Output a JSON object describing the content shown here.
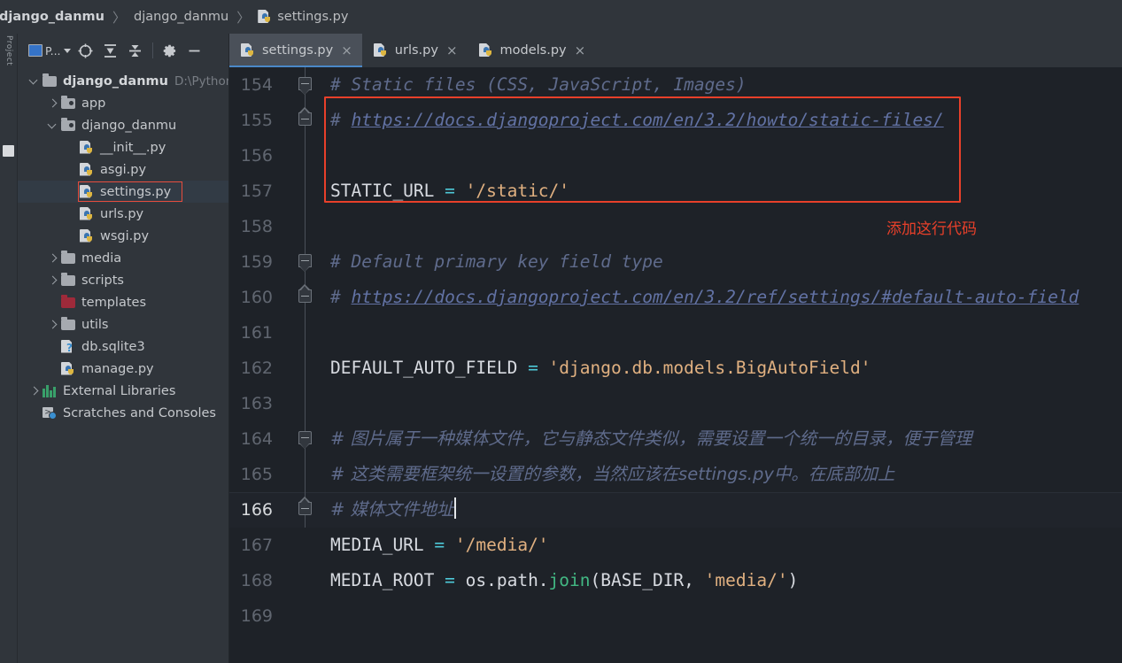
{
  "breadcrumb": {
    "items": [
      {
        "label": "django_danmu",
        "icon": "none",
        "bold": true
      },
      {
        "label": "django_danmu",
        "icon": "none",
        "bold": false
      },
      {
        "label": "settings.py",
        "icon": "python-file-icon",
        "bold": false
      }
    ],
    "separator": "〉"
  },
  "sidebar": {
    "toolbar": {
      "project_label": "P...",
      "project_icon": "project-window-icon",
      "locate_icon": "locate-target-icon",
      "expand_all_icon": "expand-all-icon",
      "collapse_all_icon": "collapse-all-icon",
      "settings_icon": "gear-icon",
      "hide_icon": "minus-icon"
    },
    "vertical_tab": "Project",
    "tree": [
      {
        "indent": 0,
        "twisty": "down",
        "icon": "folder-icon",
        "label": "django_danmu",
        "bold": true,
        "path": "D:\\Python\\",
        "selected": false
      },
      {
        "indent": 1,
        "twisty": "right",
        "icon": "source-folder-icon",
        "label": "app",
        "bold": false,
        "path": "",
        "selected": false
      },
      {
        "indent": 1,
        "twisty": "down",
        "icon": "source-folder-icon",
        "label": "django_danmu",
        "bold": false,
        "path": "",
        "selected": false
      },
      {
        "indent": 2,
        "twisty": "none",
        "icon": "python-file-icon",
        "label": "__init__.py",
        "bold": false,
        "path": "",
        "selected": false
      },
      {
        "indent": 2,
        "twisty": "none",
        "icon": "python-file-icon",
        "label": "asgi.py",
        "bold": false,
        "path": "",
        "selected": false
      },
      {
        "indent": 2,
        "twisty": "none",
        "icon": "python-file-icon",
        "label": "settings.py",
        "bold": false,
        "path": "",
        "selected": true
      },
      {
        "indent": 2,
        "twisty": "none",
        "icon": "python-file-icon",
        "label": "urls.py",
        "bold": false,
        "path": "",
        "selected": false
      },
      {
        "indent": 2,
        "twisty": "none",
        "icon": "python-file-icon",
        "label": "wsgi.py",
        "bold": false,
        "path": "",
        "selected": false
      },
      {
        "indent": 1,
        "twisty": "right",
        "icon": "folder-icon",
        "label": "media",
        "bold": false,
        "path": "",
        "selected": false
      },
      {
        "indent": 1,
        "twisty": "right",
        "icon": "folder-icon",
        "label": "scripts",
        "bold": false,
        "path": "",
        "selected": false
      },
      {
        "indent": 1,
        "twisty": "none",
        "icon": "folder-red-icon",
        "label": "templates",
        "bold": false,
        "path": "",
        "selected": false
      },
      {
        "indent": 1,
        "twisty": "right",
        "icon": "folder-icon",
        "label": "utils",
        "bold": false,
        "path": "",
        "selected": false
      },
      {
        "indent": 1,
        "twisty": "none",
        "icon": "db-file-icon",
        "label": "db.sqlite3",
        "bold": false,
        "path": "",
        "selected": false
      },
      {
        "indent": 1,
        "twisty": "none",
        "icon": "python-file-icon",
        "label": "manage.py",
        "bold": false,
        "path": "",
        "selected": false
      },
      {
        "indent": 0,
        "twisty": "right",
        "icon": "libraries-icon",
        "label": "External Libraries",
        "bold": false,
        "path": "",
        "selected": false
      },
      {
        "indent": 0,
        "twisty": "none",
        "icon": "scratches-icon",
        "label": "Scratches and Consoles",
        "bold": false,
        "path": "",
        "selected": false
      }
    ]
  },
  "editor_tabs": [
    {
      "label": "settings.py",
      "icon": "python-file-icon",
      "active": true,
      "close": "×"
    },
    {
      "label": "urls.py",
      "icon": "python-file-icon",
      "active": false,
      "close": "×"
    },
    {
      "label": "models.py",
      "icon": "python-file-icon",
      "active": false,
      "close": "×"
    }
  ],
  "editor": {
    "file": "settings.py",
    "current_line": 166,
    "lines": [
      {
        "number": 154,
        "fold": "start",
        "current": false,
        "tokens": [
          {
            "t": "# Static files (CSS, JavaScript, Images)",
            "c": "s-com"
          }
        ]
      },
      {
        "number": 155,
        "fold": "end",
        "current": false,
        "tokens": [
          {
            "t": "# ",
            "c": "s-com"
          },
          {
            "t": "https://docs.djangoproject.com/en/3.2/howto/static-files/",
            "c": "s-link"
          }
        ]
      },
      {
        "number": 156,
        "fold": "none",
        "current": false,
        "tokens": []
      },
      {
        "number": 157,
        "fold": "none",
        "current": false,
        "tokens": [
          {
            "t": "STATIC_URL ",
            "c": "s-id"
          },
          {
            "t": "= ",
            "c": "s-op"
          },
          {
            "t": "'/static/'",
            "c": "s-str"
          }
        ]
      },
      {
        "number": 158,
        "fold": "none",
        "current": false,
        "tokens": []
      },
      {
        "number": 159,
        "fold": "start",
        "current": false,
        "tokens": [
          {
            "t": "# Default primary key field type",
            "c": "s-com"
          }
        ]
      },
      {
        "number": 160,
        "fold": "end",
        "current": false,
        "tokens": [
          {
            "t": "# ",
            "c": "s-com"
          },
          {
            "t": "https://docs.djangoproject.com/en/3.2/ref/settings/#default-auto-field",
            "c": "s-link"
          }
        ]
      },
      {
        "number": 161,
        "fold": "none",
        "current": false,
        "tokens": []
      },
      {
        "number": 162,
        "fold": "none",
        "current": false,
        "tokens": [
          {
            "t": "DEFAULT_AUTO_FIELD ",
            "c": "s-id"
          },
          {
            "t": "= ",
            "c": "s-op"
          },
          {
            "t": "'django.db.models.BigAutoField'",
            "c": "s-str"
          }
        ]
      },
      {
        "number": 163,
        "fold": "none",
        "current": false,
        "tokens": []
      },
      {
        "number": 164,
        "fold": "start",
        "current": false,
        "tokens": [
          {
            "t": "# 图片属于一种媒体文件，它与静态文件类似，需要设置一个统一的目录，便于管理",
            "c": "s-com cn"
          }
        ]
      },
      {
        "number": 165,
        "fold": "none",
        "current": false,
        "tokens": [
          {
            "t": "# 这类需要框架统一设置的参数，当然应该在settings.py中。在底部加上",
            "c": "s-com cn"
          }
        ]
      },
      {
        "number": 166,
        "fold": "end",
        "current": true,
        "caret": true,
        "tokens": [
          {
            "t": "# 媒体文件地址",
            "c": "s-com cn"
          }
        ]
      },
      {
        "number": 167,
        "fold": "none",
        "current": false,
        "tokens": [
          {
            "t": "MEDIA_URL ",
            "c": "s-id"
          },
          {
            "t": "= ",
            "c": "s-op"
          },
          {
            "t": "'/media/'",
            "c": "s-str"
          }
        ]
      },
      {
        "number": 168,
        "fold": "none",
        "current": false,
        "tokens": [
          {
            "t": "MEDIA_ROOT ",
            "c": "s-id"
          },
          {
            "t": "= ",
            "c": "s-op"
          },
          {
            "t": "os.path.",
            "c": "s-id"
          },
          {
            "t": "join",
            "c": "s-fn"
          },
          {
            "t": "(BASE_DIR, ",
            "c": "s-punc"
          },
          {
            "t": "'media/'",
            "c": "s-str"
          },
          {
            "t": ")",
            "c": "s-punc"
          }
        ]
      },
      {
        "number": 169,
        "fold": "none",
        "current": false,
        "tokens": []
      }
    ]
  },
  "annotation": {
    "note_text": "添加这行代码",
    "color": "#e8402a"
  },
  "colors": {
    "background": "#1e2228",
    "panel": "#30353b",
    "selection": "#323b45",
    "tab_active": "#4a5059",
    "tab_underline": "#4a88c7",
    "comment": "#5f6b8c",
    "string": "#e0b080",
    "operator": "#4ec9d8",
    "function": "#42b883",
    "identifier": "#d7dae0",
    "annotation_red": "#e8402a"
  }
}
